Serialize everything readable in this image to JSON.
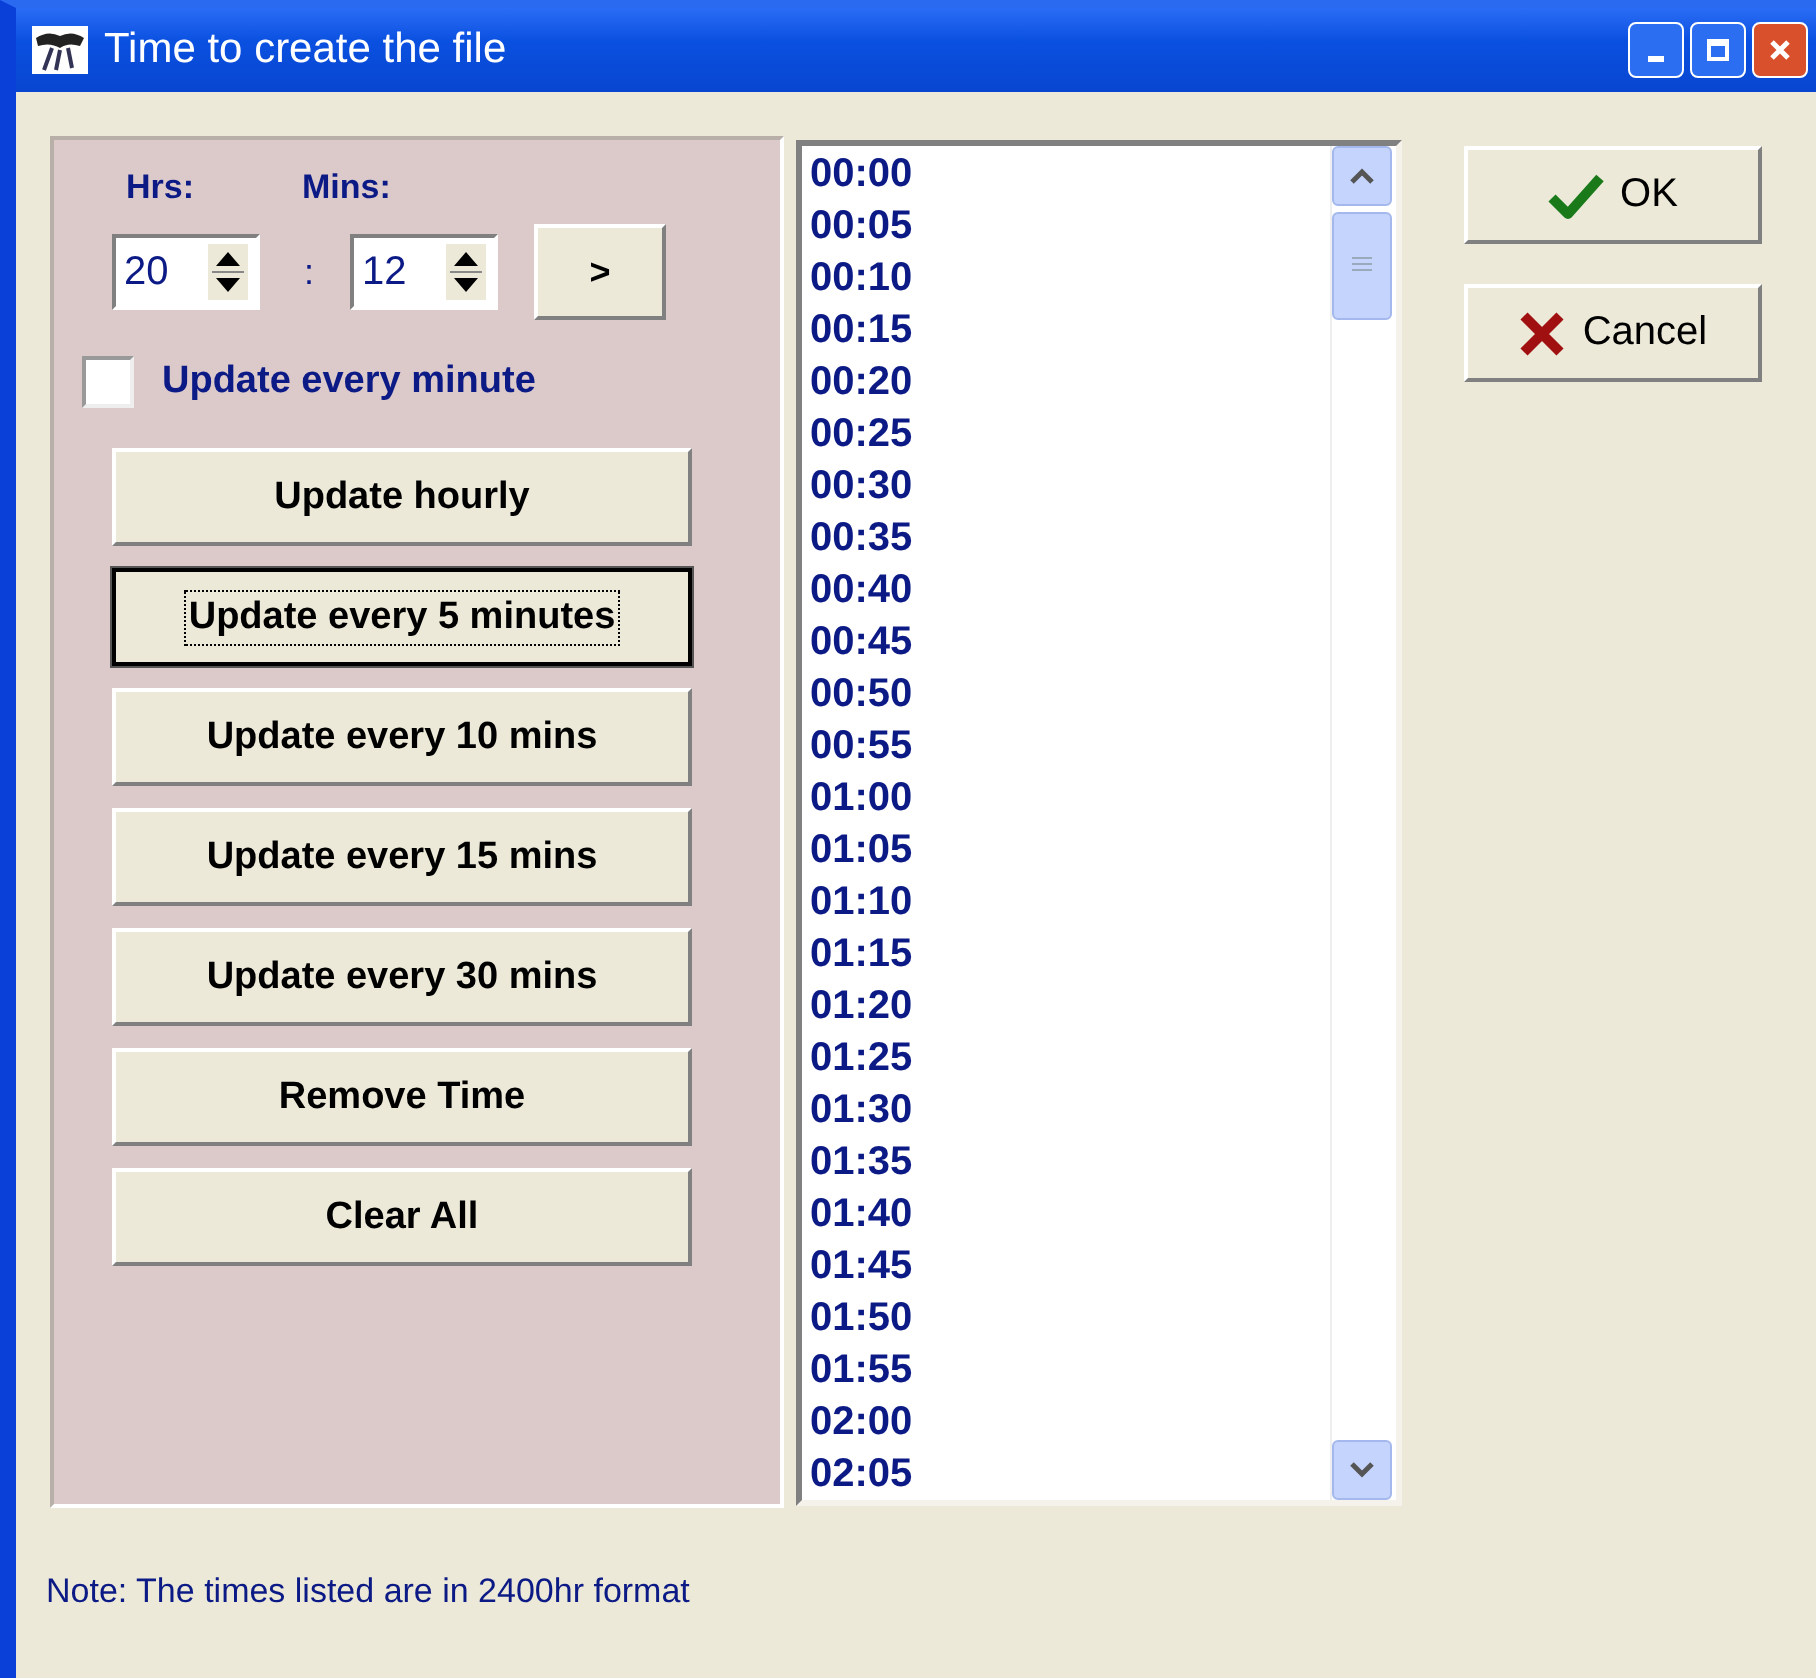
{
  "window": {
    "title": "Time to create the file"
  },
  "time": {
    "hours_label": "Hrs:",
    "minutes_label": "Mins:",
    "hours": "20",
    "separator": ":",
    "minutes": "12",
    "add_button": ">"
  },
  "update_every_minute": {
    "label": "Update every minute",
    "checked": false
  },
  "actions": [
    {
      "label": "Update hourly",
      "focused": false
    },
    {
      "label": "Update every 5 minutes",
      "focused": true
    },
    {
      "label": "Update every 10 mins",
      "focused": false
    },
    {
      "label": "Update every 15 mins",
      "focused": false
    },
    {
      "label": "Update every 30 mins",
      "focused": false
    },
    {
      "label": "Remove Time",
      "focused": false
    },
    {
      "label": "Clear All",
      "focused": false
    }
  ],
  "times": [
    "00:00",
    "00:05",
    "00:10",
    "00:15",
    "00:20",
    "00:25",
    "00:30",
    "00:35",
    "00:40",
    "00:45",
    "00:50",
    "00:55",
    "01:00",
    "01:05",
    "01:10",
    "01:15",
    "01:20",
    "01:25",
    "01:30",
    "01:35",
    "01:40",
    "01:45",
    "01:50",
    "01:55",
    "02:00",
    "02:05"
  ],
  "dialog_buttons": [
    {
      "label": "OK",
      "kind": "ok"
    },
    {
      "label": "Cancel",
      "kind": "cancel"
    }
  ],
  "note": "Note: The times listed are in 2400hr format"
}
